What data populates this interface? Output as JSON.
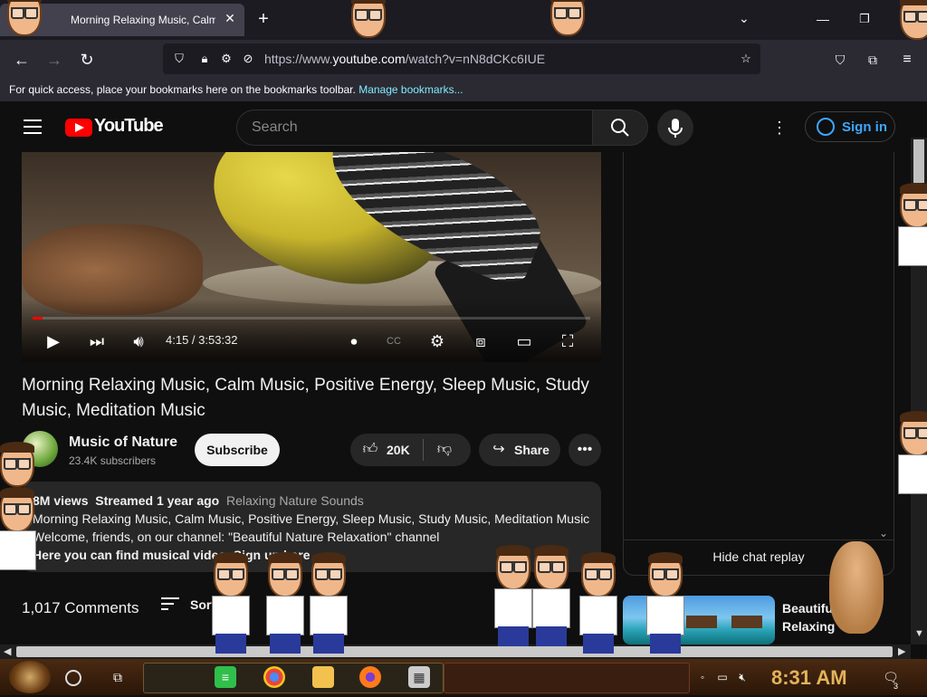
{
  "browser": {
    "tab_title": "Morning Relaxing Music, Calm",
    "url_prefix": "https://www.",
    "url_host": "youtube.com",
    "url_path": "/watch?v=nN8dCKc6IUE",
    "bookmarks_text": "For quick access, place your bookmarks here on the bookmarks toolbar.",
    "bookmarks_link": "Manage bookmarks..."
  },
  "header": {
    "logo_text": "YouTube",
    "search_placeholder": "Search",
    "signin_label": "Sign in"
  },
  "player": {
    "time": "4:15 / 3:53:32",
    "progress_fraction": 0.018
  },
  "video": {
    "title": "Morning Relaxing Music, Calm Music, Positive Energy, Sleep Music, Study Music, Meditation Music",
    "channel_name": "Music of Nature",
    "subscribers": "23.4K subscribers",
    "subscribe_label": "Subscribe",
    "likes": "20K",
    "share_label": "Share"
  },
  "description": {
    "views": "8M views",
    "streamed": "Streamed 1 year ago",
    "tag": "Relaxing Nature Sounds",
    "line1": "Morning Relaxing Music, Calm Music, Positive Energy, Sleep Music, Study Music, Meditation Music",
    "line2": "Welcome, friends, on our channel: \"Beautiful Nature Relaxation\" channel",
    "line3": "Here you can find musical video. Sign up here"
  },
  "comments": {
    "count": "1,017 Comments",
    "sort_label": "Sort by"
  },
  "chat": {
    "hide_label": "Hide chat replay"
  },
  "recommendation": {
    "title": "Beautiful Relaxing"
  },
  "taskbar": {
    "clock": "8:31 AM",
    "notifications": "3"
  },
  "colors": {
    "accent_red": "#ff0000",
    "link_blue": "#3ea6ff",
    "clock_gold": "#e3b25a"
  }
}
